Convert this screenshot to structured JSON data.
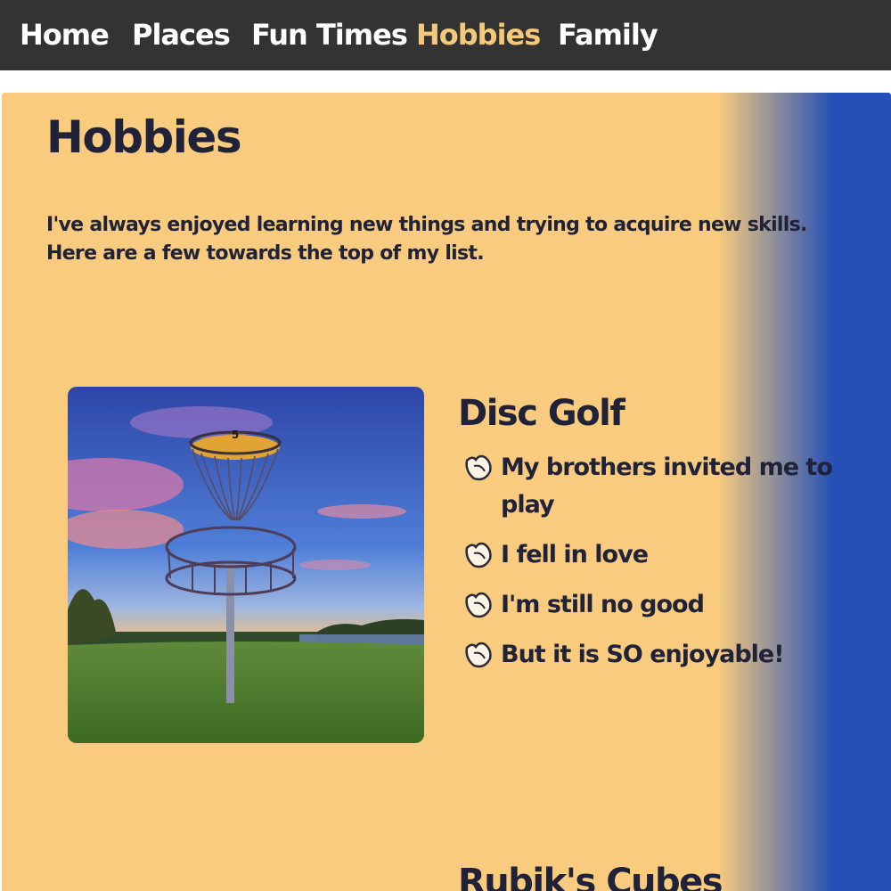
{
  "nav": {
    "items": [
      {
        "label": "Home"
      },
      {
        "label": "Places"
      },
      {
        "label": "Fun Times"
      },
      {
        "label": "Hobbies",
        "active": true
      },
      {
        "label": "Family"
      }
    ],
    "active_color": "#f5c97c",
    "background": "#333333"
  },
  "page": {
    "title": "Hobbies",
    "intro": "I've always enjoyed learning new things and trying to acquire new skills. Here are a few towards the top of my list.",
    "colors": {
      "panel_start": "#f8cb7e",
      "panel_end": "#2550b5",
      "text": "#1f2238"
    }
  },
  "hobbies": [
    {
      "title": "Disc Golf",
      "image_icon": "disc-golf-basket-photo",
      "bullet_icon": "disc-bullet-icon",
      "points": [
        "My brothers invited me to play",
        "I fell in love",
        "I'm still no good",
        "But it is SO enjoyable!"
      ]
    },
    {
      "title": "Rubik's Cubes"
    }
  ]
}
